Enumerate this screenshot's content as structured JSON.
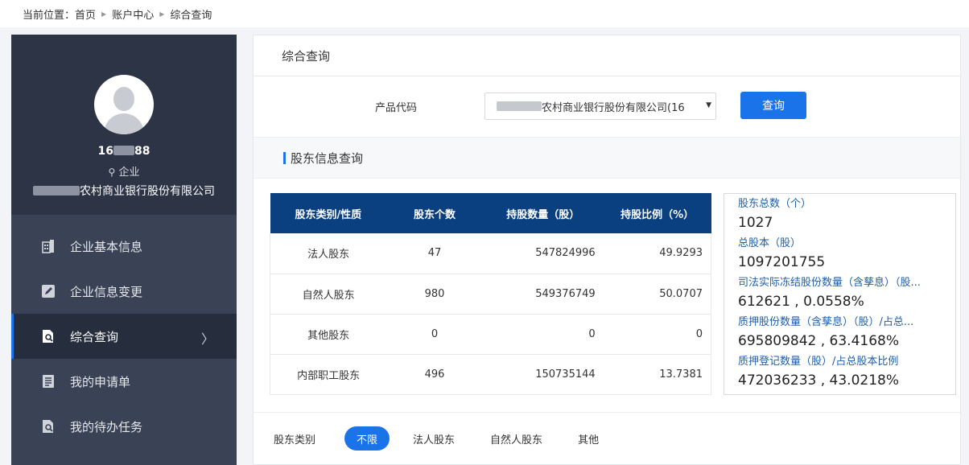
{
  "breadcrumb": {
    "prefix": "当前位置：",
    "items": [
      "首页",
      "账户中心",
      "综合查询"
    ]
  },
  "profile": {
    "uid_prefix": "16",
    "uid_suffix": "88",
    "role": "企业",
    "org_suffix": "农村商业银行股份有限公司"
  },
  "menu": [
    {
      "label": "企业基本信息",
      "icon": "building-icon"
    },
    {
      "label": "企业信息变更",
      "icon": "edit-icon"
    },
    {
      "label": "综合查询",
      "icon": "search-doc-icon",
      "active": true
    },
    {
      "label": "我的申请单",
      "icon": "list-doc-icon"
    },
    {
      "label": "我的待办任务",
      "icon": "task-doc-icon"
    }
  ],
  "panel": {
    "title": "综合查询"
  },
  "query": {
    "label": "产品代码",
    "selected": "农村商业银行股份有限公司(16",
    "button": "查询"
  },
  "section": {
    "title": "股东信息查询"
  },
  "table": {
    "headers": [
      "股东类别/性质",
      "股东个数",
      "持股数量（股）",
      "持股比例（%）"
    ],
    "rows": [
      [
        "法人股东",
        "47",
        "547824996",
        "49.9293"
      ],
      [
        "自然人股东",
        "980",
        "549376749",
        "50.0707"
      ],
      [
        "其他股东",
        "0",
        "0",
        "0"
      ],
      [
        "内部职工股东",
        "496",
        "150735144",
        "13.7381"
      ]
    ]
  },
  "summary": [
    {
      "label": "股东总数（个）",
      "value": "1027"
    },
    {
      "label": "总股本（股）",
      "value": "1097201755"
    },
    {
      "label": "司法实际冻结股份数量（含孳息）（股...",
      "value": "612621 , 0.0558%"
    },
    {
      "label": "质押股份数量（含孳息）（股）/占总...",
      "value": "695809842 , 63.4168%"
    },
    {
      "label": "质押登记数量（股）/占总股本比例",
      "value": "472036233 , 43.0218%"
    }
  ],
  "filter": {
    "label": "股东类别",
    "options": [
      "不限",
      "法人股东",
      "自然人股东",
      "其他"
    ],
    "selected": "不限"
  },
  "colors": {
    "accent": "#1a73e8",
    "header_navy": "#0a3f80",
    "sidebar": "#3a4256",
    "sidebar_dark": "#2c3446"
  }
}
